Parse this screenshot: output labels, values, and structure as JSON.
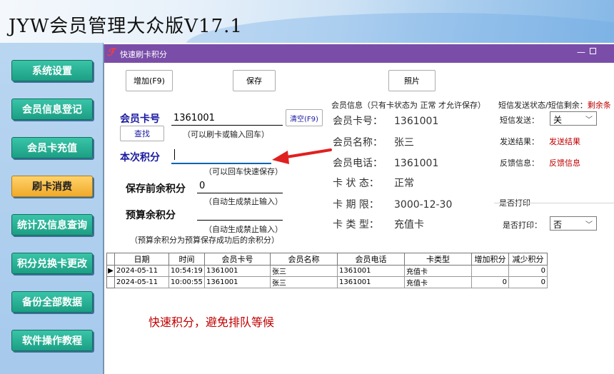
{
  "app": {
    "title": "JYW会员管理大众版V17.1"
  },
  "nav": {
    "items": [
      {
        "label": "系统设置"
      },
      {
        "label": "会员信息登记"
      },
      {
        "label": "会员卡充值"
      },
      {
        "label": "刷卡消费",
        "active": true
      },
      {
        "label": "统计及信息查询"
      },
      {
        "label": "积分兑换卡更改"
      },
      {
        "label": "备份全部数据"
      },
      {
        "label": "软件操作教程"
      }
    ]
  },
  "window": {
    "title": "快速刷卡积分",
    "logo": "ℱ",
    "minimize": "—"
  },
  "toolbar": {
    "add_label": "增加(F9)",
    "save_label": "保存",
    "photo_label": "照片"
  },
  "form": {
    "card_label": "会员卡号",
    "card_value": "1361001",
    "clear_label": "清空(F9)",
    "find_label": "查找",
    "card_hint": "（可以刷卡或输入回车）",
    "points_label": "本次积分",
    "points_value": "",
    "points_hint": "（可以回车快速保存）",
    "before_label": "保存前余积分",
    "before_value": "0",
    "before_hint": "（自动生成禁止输入）",
    "budget_label": "预算余积分",
    "budget_value": "",
    "budget_hint": "（自动生成禁止输入）",
    "budget_note": "（预算余积分为预算保存成功后的余积分）"
  },
  "member_info": {
    "heading": "会员信息（只有卡状态为 正常 才允许保存）",
    "rows": [
      {
        "label": "会员卡号：",
        "value": "1361001"
      },
      {
        "label": "会员名称：",
        "value": "张三"
      },
      {
        "label": "会员电话：",
        "value": "1361001"
      },
      {
        "label": "卡 状 态：",
        "value": "正常"
      },
      {
        "label": "卡 期 限：",
        "value": "3000-12-30"
      },
      {
        "label": "卡 类 型：",
        "value": "充值卡"
      }
    ]
  },
  "sms": {
    "heading": "短信发送状态/短信剩余：",
    "heading_extra": "剩余条",
    "send_label": "短信发送：",
    "send_value": "关",
    "result_label": "发送结果：",
    "result_value": "发送结果",
    "feedback_label": "反馈信息：",
    "feedback_value": "反馈信息"
  },
  "print": {
    "heading": "是否打印",
    "label": "是否打印：",
    "value": "否"
  },
  "table": {
    "columns": [
      "日期",
      "时间",
      "会员卡号",
      "会员名称",
      "会员电话",
      "卡类型",
      "增加积分",
      "减少积分"
    ],
    "rows": [
      {
        "indicator": "▶",
        "cells": [
          "2024-05-11",
          "10:54:19",
          "1361001",
          "张三",
          "1361001",
          "充值卡",
          "",
          "0"
        ]
      },
      {
        "indicator": "",
        "cells": [
          "2024-05-11",
          "10:00:55",
          "1361001",
          "张三",
          "1361001",
          "充值卡",
          "0",
          "0"
        ]
      }
    ]
  },
  "slogan": "快速积分，避免排队等候",
  "colors": {
    "titlebar": "#7a4ea8",
    "nav_button": "#1c9f84",
    "nav_active": "#f0a92a",
    "arrow": "#e02020",
    "accent_text": "#1a1aa0"
  }
}
